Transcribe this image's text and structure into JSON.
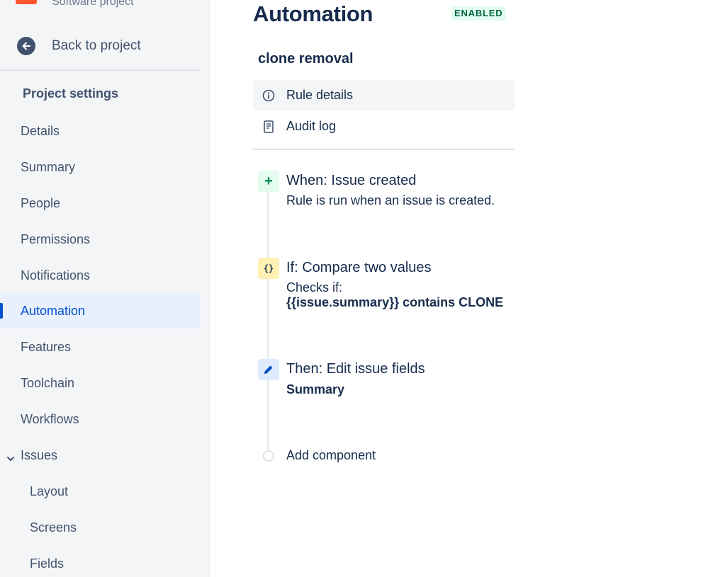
{
  "sidebar": {
    "project_type": "Software project",
    "back_label": "Back to project",
    "section_heading": "Project settings",
    "items": [
      {
        "label": "Details"
      },
      {
        "label": "Summary"
      },
      {
        "label": "People"
      },
      {
        "label": "Permissions"
      },
      {
        "label": "Notifications"
      },
      {
        "label": "Automation",
        "active": true
      },
      {
        "label": "Features"
      },
      {
        "label": "Toolchain"
      },
      {
        "label": "Workflows"
      },
      {
        "label": "Issues",
        "expanded": true
      },
      {
        "label": "Layout"
      },
      {
        "label": "Screens"
      },
      {
        "label": "Fields"
      }
    ]
  },
  "main": {
    "title": "Automation",
    "status_badge": "ENABLED",
    "rule_name": "clone removal",
    "tabs": [
      {
        "label": "Rule details",
        "icon": "info-icon",
        "active": true
      },
      {
        "label": "Audit log",
        "icon": "document-icon"
      }
    ],
    "steps": {
      "trigger": {
        "title": "When: Issue created",
        "description": "Rule is run when an issue is created.",
        "icon": "plus-icon"
      },
      "condition": {
        "title": "If: Compare two values",
        "description": "Checks if:",
        "detail": "{{issue.summary}} contains CLONE",
        "icon": "braces-icon"
      },
      "action": {
        "title": "Then: Edit issue fields",
        "detail": "Summary",
        "icon": "pencil-icon"
      }
    },
    "add_component": "Add component"
  },
  "colors": {
    "accent": "#0052cc",
    "enabled_bg": "#e3fcef",
    "enabled_text": "#006644",
    "condition_bg": "#fff0b3",
    "action_bg": "#deebff"
  }
}
